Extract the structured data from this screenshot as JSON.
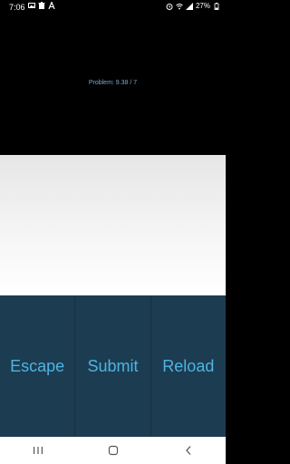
{
  "status_bar": {
    "time": "7:06",
    "battery": "27%",
    "left_icons": [
      "photo-icon",
      "delete-icon",
      "a-icon"
    ],
    "right_icons": [
      "alarm-icon",
      "wifi-icon",
      "signal-icon",
      "battery-icon"
    ]
  },
  "problem": {
    "text": "Problem: 9.38 / 7"
  },
  "buttons": {
    "escape": "Escape",
    "submit": "Submit",
    "reload": "Reload"
  },
  "nav": {
    "items": [
      "recents-icon",
      "home-icon",
      "back-icon"
    ]
  },
  "colors": {
    "accent": "#4fb3e2",
    "button_bg": "#1c3c51",
    "problem_text": "#7fa7c9"
  }
}
